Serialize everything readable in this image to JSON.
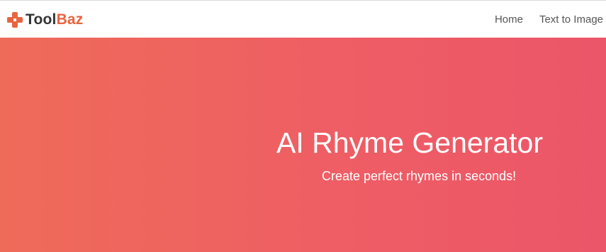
{
  "navbar": {
    "logo": {
      "icon": "toolbaz-logo-icon",
      "text_part1": "Tool",
      "text_part2": "Baz",
      "colors": {
        "tool": "#333333",
        "baz": "#e8643f"
      }
    },
    "links": [
      {
        "label": "Home"
      },
      {
        "label": "Text to Image"
      }
    ]
  },
  "hero": {
    "title": "AI Rhyme Generator",
    "subtitle": "Create perfect rhymes in seconds!",
    "gradient": [
      "#ef6b59",
      "#ec5669"
    ],
    "text_color": "#ffffff"
  }
}
